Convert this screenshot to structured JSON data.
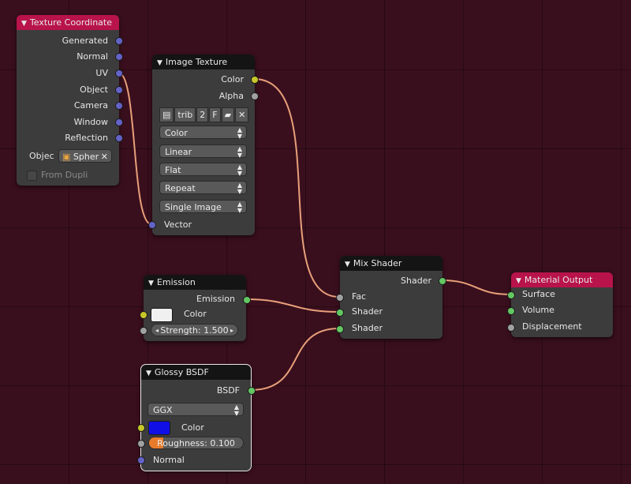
{
  "colors": {
    "background": "#3a0f1d",
    "node_body": "#3c3c3c",
    "node_header": "#141414",
    "io_header": "#b8134b",
    "wire": "#e8a07a",
    "socket_vector": "#6363c7",
    "socket_color": "#c7c729",
    "socket_gray": "#a1a1a1",
    "socket_shader": "#63c763",
    "emission_color": "#f0f0f0",
    "glossy_color": "#1010e6",
    "roughness_fill": "#e87b2a"
  },
  "texture_coordinate": {
    "title": "Texture Coordinate",
    "outputs": [
      "Generated",
      "Normal",
      "UV",
      "Object",
      "Camera",
      "Window",
      "Reflection"
    ],
    "object_label": "Objec",
    "object_value": "Spher",
    "object_icon": "cube-icon",
    "from_dupli": "From Dupli"
  },
  "image_texture": {
    "title": "Image Texture",
    "outputs": [
      "Color",
      "Alpha"
    ],
    "image_name": "trib",
    "users": "2",
    "fake_user": "F",
    "color_space": "Color",
    "interpolation": "Linear",
    "projection": "Flat",
    "extension": "Repeat",
    "source": "Single Image",
    "input": "Vector"
  },
  "emission": {
    "title": "Emission",
    "output": "Emission",
    "color_label": "Color",
    "strength_label": "Strength:",
    "strength_value": "1.500"
  },
  "glossy": {
    "title": "Glossy BSDF",
    "output": "BSDF",
    "distribution": "GGX",
    "color_label": "Color",
    "roughness_label": "Roughness:",
    "roughness_value": "0.100",
    "roughness": 0.1,
    "normal_label": "Normal"
  },
  "mix_shader": {
    "title": "Mix Shader",
    "output": "Shader",
    "inputs": [
      "Fac",
      "Shader",
      "Shader"
    ]
  },
  "material_output": {
    "title": "Material Output",
    "inputs": [
      "Surface",
      "Volume",
      "Displacement"
    ]
  }
}
